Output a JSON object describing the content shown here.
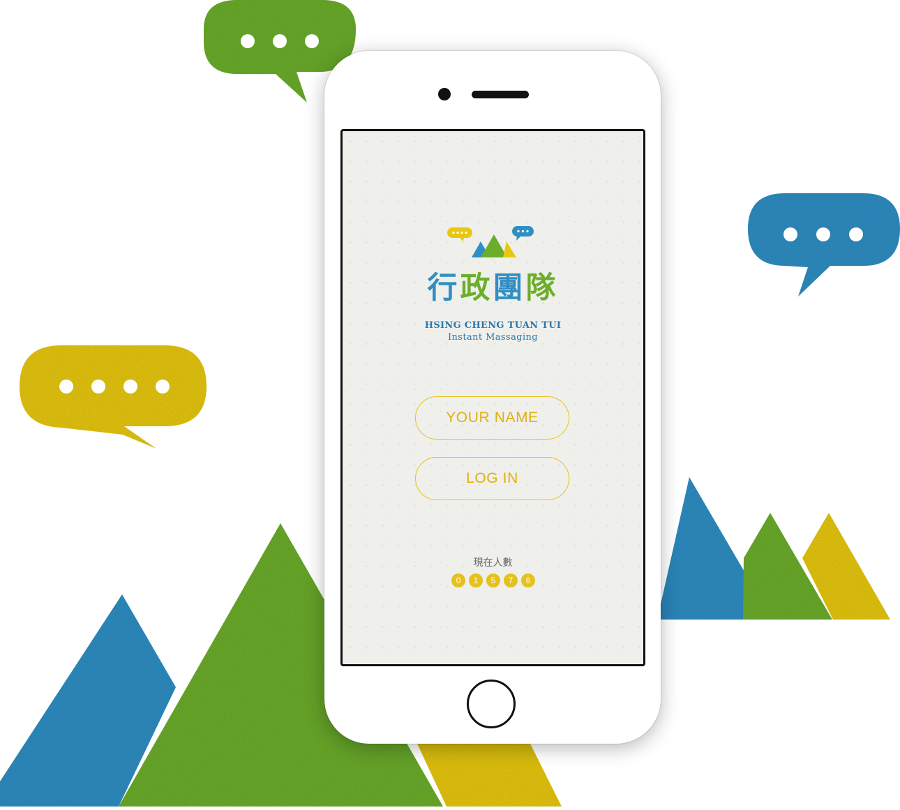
{
  "app": {
    "title_chars": [
      "行",
      "政",
      "團",
      "隊"
    ],
    "subtitle_line1": "HSING CHENG TUAN TUI",
    "subtitle_line2": "Instant Massaging"
  },
  "login": {
    "name_placeholder": "YOUR NAME",
    "login_label": "LOG IN"
  },
  "online": {
    "label": "現在人數",
    "digits": [
      "0",
      "1",
      "5",
      "7",
      "6"
    ]
  },
  "colors": {
    "blue": "#2f8fc4",
    "green": "#6cae2c",
    "yellow": "#e8c80f",
    "accent_text": "#e0b010"
  }
}
